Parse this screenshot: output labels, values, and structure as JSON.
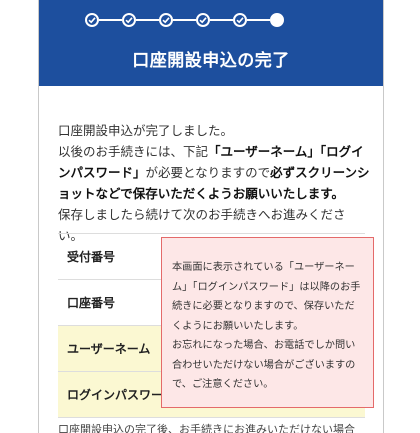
{
  "progress": {
    "total_steps": 6,
    "completed_steps": 5,
    "current_step": 6
  },
  "header": {
    "title": "口座開設申込の完了"
  },
  "message": {
    "line1": "口座開設申込が完了しました。",
    "line2_prefix": "以後のお手続きには、下記",
    "line2_bold_username": "「ユーザーネーム」「ログインパスワード」",
    "line2_mid": "が必要となりますので",
    "line2_bold_screenshot": "必ずスクリーンショットなどで保存いただくようお願いいたします。",
    "line3": "保存しましたら続けて次のお手続きへお進みください。"
  },
  "table": {
    "rows": [
      {
        "label": "受付番号",
        "highlight": false
      },
      {
        "label": "口座番号",
        "highlight": false
      },
      {
        "label": "ユーザーネーム",
        "highlight": true
      },
      {
        "label": "ログインパスワード",
        "highlight": true
      }
    ]
  },
  "notice": {
    "line1": "本画面に表示されている「ユーザーネーム」「ログインパスワード」は以降のお手続きに必要となりますので、保存いただくようにお願いいたします。",
    "line2": "お忘れになった場合、お電話でしか問い合わせいただけない場合がございますので、ご注意ください。"
  },
  "footer": {
    "text": "口座開設申込の完了後、お手続きにお進みいただけない場合"
  },
  "colors": {
    "header_bg": "#1d4f9e",
    "highlight_row": "#fbf8d2",
    "notice_bg": "#fde7e7",
    "notice_border": "#e46a6a"
  }
}
